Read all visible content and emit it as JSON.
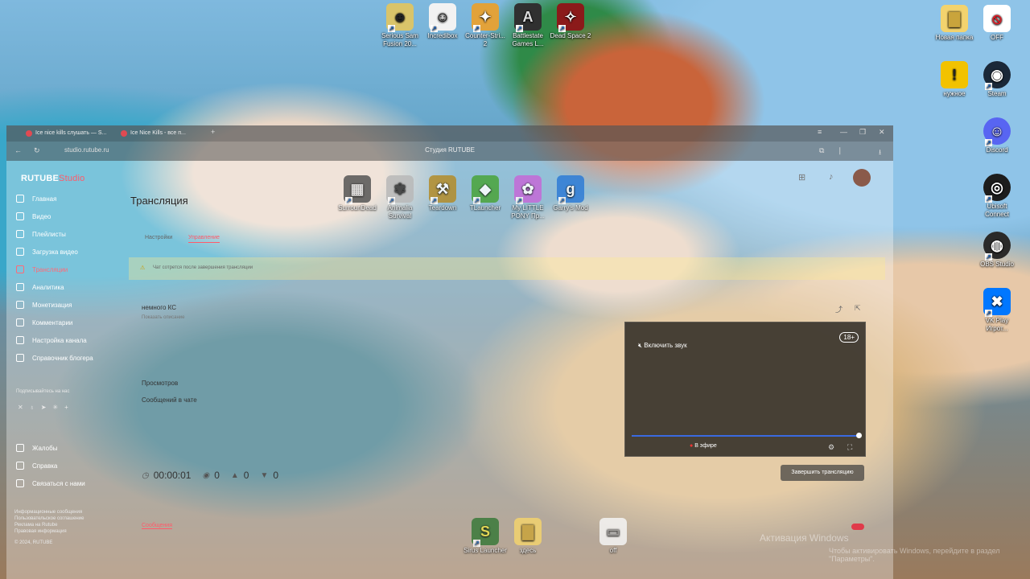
{
  "desktop": {
    "top_icons": [
      {
        "label": "Serious Sam Fusion 20...",
        "icon": "serious-sam-icon",
        "color": "#d9c46a",
        "glyph": "☻"
      },
      {
        "label": "Incredibox",
        "icon": "incredibox-icon",
        "color": "#f2f2f2",
        "glyph": "☺"
      },
      {
        "label": "Counter-Stri... 2",
        "icon": "counter-strike-icon",
        "color": "#e2a23a",
        "glyph": "✦"
      },
      {
        "label": "Battlestate Games L...",
        "icon": "battlestate-icon",
        "color": "#303030",
        "glyph": "A"
      },
      {
        "label": "Dead Space 2",
        "icon": "dead-space-icon",
        "color": "#8b1a1a",
        "glyph": "✧"
      }
    ],
    "right_icons": [
      {
        "label": "Новая папка",
        "icon": "folder-icon",
        "color": "#f3d36e",
        "glyph": "▇"
      },
      {
        "label": "OFF",
        "icon": "off-icon",
        "color": "#ffffff",
        "glyph": "⦸"
      },
      {
        "label": "нужное",
        "icon": "shield-icon",
        "color": "#f2c200",
        "glyph": "!"
      },
      {
        "label": "Steam",
        "icon": "steam-icon",
        "color": "#1b2838",
        "glyph": "◉"
      },
      {
        "label": "Discord",
        "icon": "discord-icon",
        "color": "#5865f2",
        "glyph": "☺"
      },
      {
        "label": "Ubisoft Connect",
        "icon": "ubisoft-icon",
        "color": "#1d1d1d",
        "glyph": "◎"
      },
      {
        "label": "OBS Studio",
        "icon": "obs-icon",
        "color": "#2a2a2a",
        "glyph": "◍"
      },
      {
        "label": "VK Play Игрот...",
        "icon": "vkplay-icon",
        "color": "#0077ff",
        "glyph": "✖"
      }
    ],
    "mid_icons": [
      {
        "label": "SurrounDead",
        "icon": "surrounddead-icon",
        "color": "#555555",
        "glyph": "▦"
      },
      {
        "label": "Animalia Survival",
        "icon": "animalia-icon",
        "color": "#b9b9b9",
        "glyph": "✾"
      },
      {
        "label": "Teardown",
        "icon": "teardown-icon",
        "color": "#b38c2a",
        "glyph": "⚒"
      },
      {
        "label": "TLauncher",
        "icon": "tlauncher-icon",
        "color": "#4aa43a",
        "glyph": "◆"
      },
      {
        "label": "My LITTLE PONY Пр...",
        "icon": "pony-icon",
        "color": "#c56ad8",
        "glyph": "✿"
      },
      {
        "label": "Garry's Mod",
        "icon": "garrysmod-icon",
        "color": "#2e7cd6",
        "glyph": "g"
      }
    ],
    "bottom_icons": [
      {
        "label": "Sirus Launcher",
        "icon": "sirus-icon",
        "color": "#3a7a3a",
        "glyph": "S"
      },
      {
        "label": "здесь",
        "icon": "folder-icon",
        "color": "#f3d36e",
        "glyph": "▇"
      },
      {
        "label": "off",
        "icon": "file-icon",
        "color": "#f5f5f5",
        "glyph": "▭"
      }
    ],
    "watermark_line1": "Активация Windows",
    "watermark_line2": "Чтобы активировать Windows, перейдите в раздел \"Параметры\"."
  },
  "browser": {
    "tab1": "Ice nice kills слушать — S...",
    "tab2": "Ice Nice Kills - все п...",
    "url": "studio.rutube.ru",
    "page_title": "Студия RUTUBE"
  },
  "studio": {
    "logo_main": "RUTUBE",
    "logo_studio": "Studio",
    "nav": [
      "Главная",
      "Видео",
      "Плейлисты",
      "Загрузка видео",
      "Трансляции",
      "Аналитика",
      "Монетизация",
      "Комментарии",
      "Настройка канала",
      "Справочник блогера"
    ],
    "social_caption": "Подписывайтесь на нас",
    "support": [
      "Жалобы",
      "Справка",
      "Связаться с нами"
    ],
    "footer": [
      "Информационные сообщения",
      "Пользовательское соглашение",
      "Реклама на Rutube",
      "Правовая информация",
      "© 2024, RUTUBE"
    ],
    "title": "Трансляция",
    "subtabs": [
      "Настройки",
      "Управление"
    ],
    "banner": "Чат сотрется после завершения трансляции",
    "stream_name": "немного КС",
    "stream_desc": "Показать описание",
    "views_label": "Просмотров",
    "chat_label": "Сообщений в чате",
    "timer": "00:00:01",
    "count_viewers": "0",
    "count_likes": "0",
    "count_dislikes": "0",
    "messages_tab": "Сообщения"
  },
  "player": {
    "mute_label": "Включить звук",
    "age": "18+",
    "live_label": "В эфире",
    "end_button": "Завершить трансляцию",
    "progress": 1.0
  }
}
